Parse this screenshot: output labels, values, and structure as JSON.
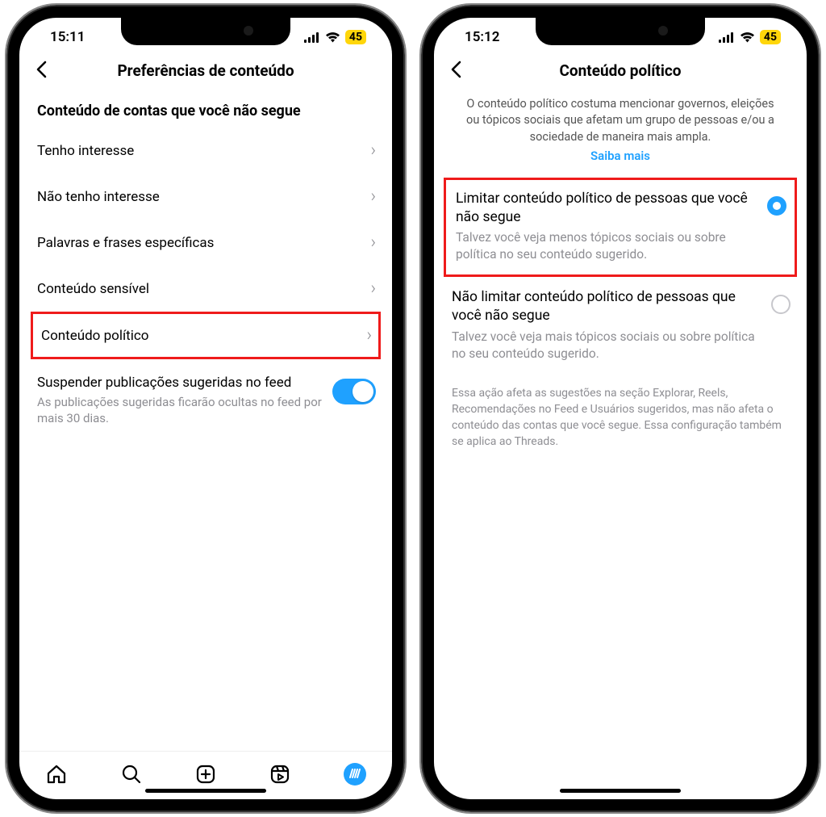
{
  "left": {
    "status": {
      "time": "15:11",
      "battery": "45"
    },
    "header_title": "Preferências de conteúdo",
    "section_title": "Conteúdo de contas que você não segue",
    "rows": [
      {
        "label": "Tenho interesse"
      },
      {
        "label": "Não tenho interesse"
      },
      {
        "label": "Palavras e frases específicas"
      },
      {
        "label": "Conteúdo sensível"
      },
      {
        "label": "Conteúdo político"
      }
    ],
    "toggle": {
      "title": "Suspender publicações sugeridas no feed",
      "sub": "As publicações sugeridas ficarão ocultas no feed por mais 30 dias."
    }
  },
  "right": {
    "status": {
      "time": "15:12",
      "battery": "45"
    },
    "header_title": "Conteúdo político",
    "intro": "O conteúdo político costuma mencionar governos, eleições ou tópicos sociais que afetam um grupo de pessoas e/ou a sociedade de maneira mais ampla.",
    "learn_more": "Saiba mais",
    "options": [
      {
        "title": "Limitar conteúdo político de pessoas que você não segue",
        "sub": "Talvez você veja menos tópicos sociais ou sobre política no seu conteúdo sugerido.",
        "checked": true
      },
      {
        "title": "Não limitar conteúdo político de pessoas que você não segue",
        "sub": "Talvez você veja mais tópicos sociais ou sobre política no seu conteúdo sugerido.",
        "checked": false
      }
    ],
    "footnote": "Essa ação afeta as sugestões na seção Explorar, Reels, Recomendações no Feed e Usuários sugeridos, mas não afeta o conteúdo das contas que você segue. Essa configuração também se aplica ao Threads."
  }
}
